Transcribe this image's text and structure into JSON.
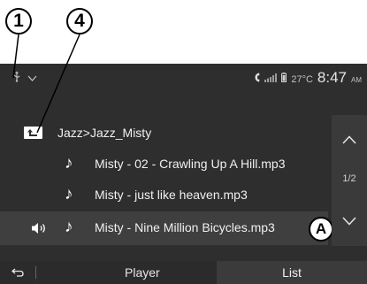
{
  "callouts": {
    "c1": "1",
    "c4": "4",
    "badge": "A"
  },
  "status": {
    "temperature": "27°C",
    "time": "8:47",
    "ampm": "AM"
  },
  "folder": {
    "path": "Jazz>Jazz_Misty"
  },
  "tracks": [
    {
      "title": "Misty - 02 - Crawling Up A Hill.mp3",
      "playing": false
    },
    {
      "title": "Misty - just like heaven.mp3",
      "playing": false
    },
    {
      "title": "Misty - Nine Million Bicycles.mp3",
      "playing": true
    }
  ],
  "pagination": {
    "indicator": "1/2"
  },
  "tabs": {
    "player": "Player",
    "list": "List"
  },
  "colors": {
    "screen_bg": "#2e2e2e",
    "selected_row": "#3f3f3f",
    "text": "#f0f0f0"
  },
  "icons": {
    "source": "usb-icon",
    "dropdown": "chevron-down-icon",
    "phone": "phone-icon",
    "signal": "signal-icon",
    "battery": "battery-icon",
    "folder": "folder-up-icon",
    "track": "music-note-icon",
    "now_playing": "speaker-icon",
    "scroll_up": "chevron-up-icon",
    "scroll_down": "chevron-down-icon",
    "back": "back-arrow-icon"
  }
}
